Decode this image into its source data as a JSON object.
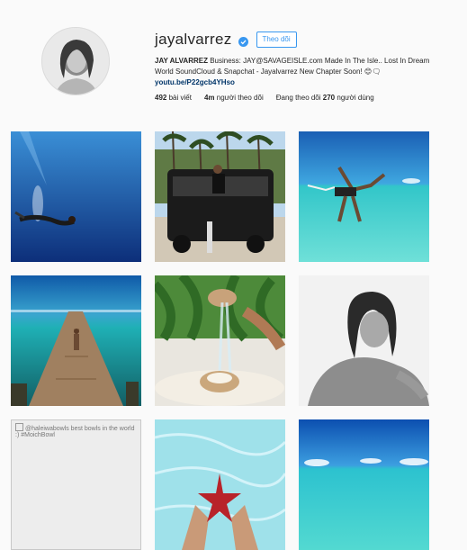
{
  "profile": {
    "username": "jayalvarrez",
    "follow_label": "Theo dõi",
    "bio_name": "JAY ALVARREZ",
    "bio_text": " Business: JAY@SAVAGEISLE.com Made In The Isle.. Lost In Dream World SoundCloud & Snapchat - Jayalvarrez New Chapter Soon! 😊🗨",
    "bio_link": "youtu.be/P22gcb4YHso",
    "stats": {
      "posts_count": "492",
      "posts_label": "bài viết",
      "followers_count": "4m",
      "followers_label": "người theo dõi",
      "following_prefix": "Đang theo dõi",
      "following_count": "270",
      "following_label": "người dùng"
    }
  },
  "posts": {
    "broken_alt": "@haleiwabowls best bowls in the world :) #MoichBowl"
  },
  "colors": {
    "link_blue": "#3897f0",
    "verified_blue": "#3897f0",
    "background": "#fafafa"
  }
}
